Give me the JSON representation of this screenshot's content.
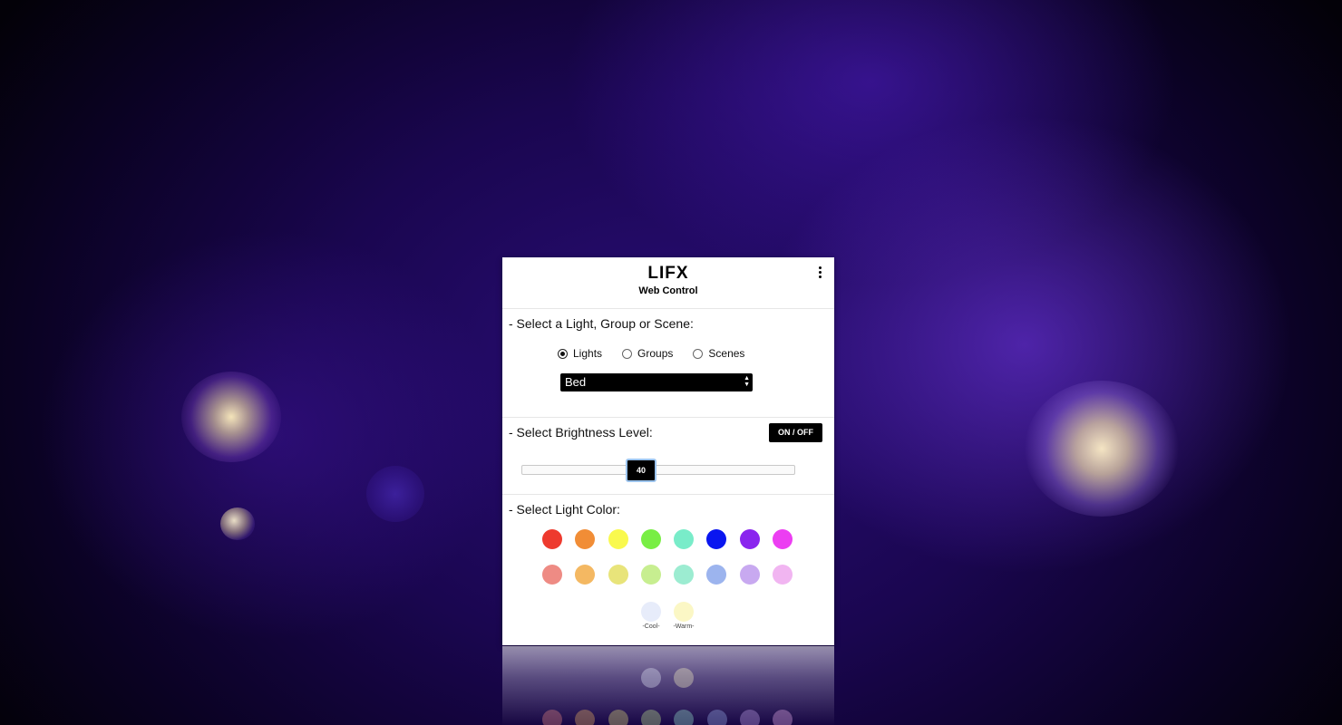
{
  "app": {
    "logo": "LIFX",
    "subtitle": "Web Control",
    "menu_icon": "more-vertical-icon"
  },
  "select_section": {
    "title": "- Select a Light, Group or Scene:",
    "options": [
      {
        "label": "Lights",
        "checked": true
      },
      {
        "label": "Groups",
        "checked": false
      },
      {
        "label": "Scenes",
        "checked": false
      }
    ],
    "dropdown": {
      "selected": "Bed",
      "icon": "updown-arrows-icon"
    }
  },
  "brightness_section": {
    "title": "- Select Brightness Level:",
    "toggle_label": "ON / OFF",
    "slider_value": "40",
    "slider_fraction": 0.44
  },
  "color_section": {
    "title": "- Select Light Color:",
    "row1": [
      "#ee3a2e",
      "#f18d36",
      "#f9f94e",
      "#78ee44",
      "#79ecc9",
      "#0a16f0",
      "#8a24ee",
      "#ec3ef2"
    ],
    "row2": [
      "#ee8b84",
      "#f4b862",
      "#e8e47a",
      "#c7ee90",
      "#9cecd1",
      "#9cb4ee",
      "#c8a9f0",
      "#f1b5f1"
    ],
    "temps": [
      {
        "label": "-Cool-",
        "color": "#e7ecfa"
      },
      {
        "label": "-Warm-",
        "color": "#fbf7c5"
      }
    ]
  },
  "background": {
    "base": "#1a0650",
    "glow": "#7a3cf0"
  }
}
